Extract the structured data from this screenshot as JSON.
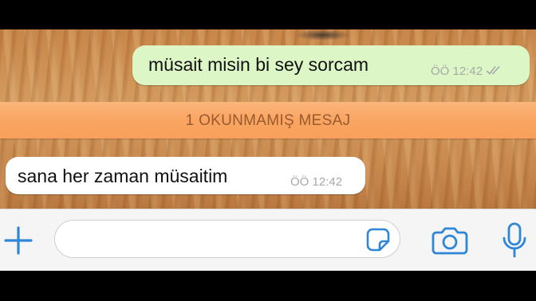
{
  "colors": {
    "accent": "#2f86d6",
    "outgoing_bubble": "#dcf6c6",
    "incoming_bubble": "#ffffff",
    "unread_banner": "#f9a562",
    "unread_text": "#9a5a2c",
    "meta_text": "#a8a8a8"
  },
  "messages": [
    {
      "direction": "outgoing",
      "text": "müsait misin bi sey sorcam",
      "time": "ÖÖ 12:42",
      "status_icon": "double-check-icon"
    },
    {
      "direction": "incoming",
      "text": "sana her zaman müsaitim",
      "time": "ÖÖ 12:42"
    }
  ],
  "unread_banner": {
    "label": "1 OKUNMAMIŞ MESAJ"
  },
  "input_bar": {
    "value": "",
    "icons": {
      "attach": "plus-icon",
      "sticker": "sticker-icon",
      "camera": "camera-icon",
      "mic": "microphone-icon"
    }
  }
}
